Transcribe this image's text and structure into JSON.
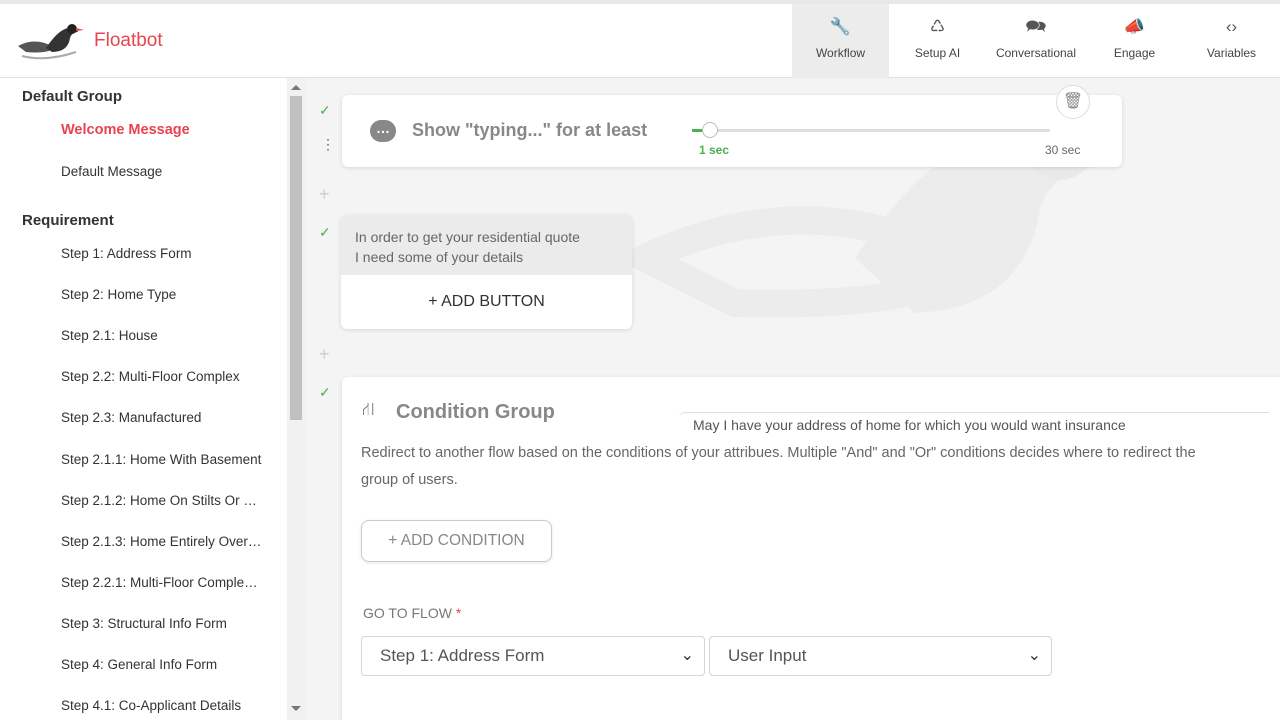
{
  "header": {
    "brand": "Floatbot",
    "nav": [
      {
        "label": "Workflow",
        "icon": "wrench-icon",
        "glyph": "🔧",
        "active": true
      },
      {
        "label": "Setup AI",
        "icon": "brain-icon",
        "glyph": "♺",
        "active": false
      },
      {
        "label": "Conversational",
        "icon": "chat-icon",
        "glyph": "🗪",
        "active": false
      },
      {
        "label": "Engage",
        "icon": "megaphone-icon",
        "glyph": "📣",
        "active": false
      },
      {
        "label": "Variables",
        "icon": "code-icon",
        "glyph": "‹›",
        "active": false
      }
    ]
  },
  "sidebar": {
    "groups": [
      {
        "title": "Default Group",
        "items": [
          "Welcome Message",
          "Default Message"
        ]
      },
      {
        "title": "Requirement",
        "items": [
          "Step 1: Address Form",
          "Step 2: Home Type",
          "Step 2.1: House",
          "Step 2.2: Multi-Floor Complex",
          "Step 2.3: Manufactured",
          "Step 2.1.1: Home With Basement",
          "Step 2.1.2: Home On Stilts Or …",
          "Step 2.1.3: Home Entirely Over…",
          "Step 2.2.1: Multi-Floor Comple…",
          "Step 3: Structural Info Form",
          "Step 4: General Info Form",
          "Step 4.1: Co-Applicant Details"
        ]
      }
    ],
    "active_item": "Welcome Message"
  },
  "typing": {
    "label": "Show \"typing...\" for at least",
    "min_label": "1 sec",
    "max_label": "30 sec",
    "value_fraction": 0.0
  },
  "message": {
    "line1": "In order to get your residential quote",
    "line2": "I need some of your details",
    "add_button": "+ ADD BUTTON"
  },
  "condition": {
    "title": "Condition Group",
    "desc_line1": "Redirect to another flow based on the conditions of your attribues. Multiple \"And\" and \"Or\" conditions decides where to redirect the",
    "desc_line2": "group of users.",
    "add_condition": "+ ADD CONDITION",
    "go_to_flow_label": "GO TO FLOW",
    "required_mark": "*",
    "flow_select": "Step 1: Address Form",
    "input_select": "User Input",
    "bottom_hint": "May I have your address of home for which you would want insurance"
  },
  "colors": {
    "brand": "#e8434f",
    "success": "#4caf50"
  }
}
